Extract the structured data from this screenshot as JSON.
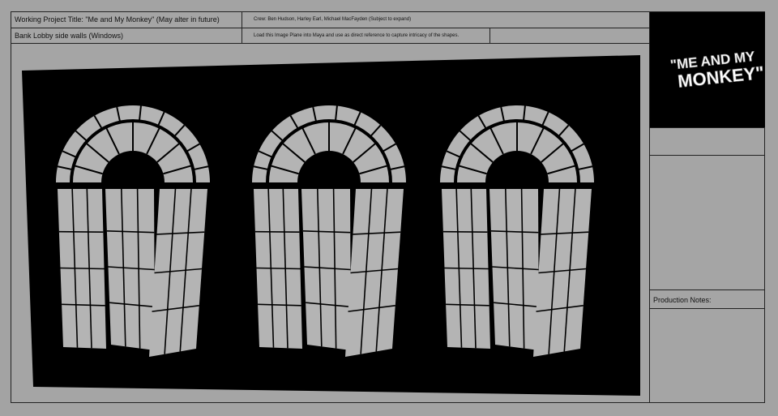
{
  "header": {
    "project_title": "Working Project Title: \"Me and My Monkey\" (May alter in future)",
    "crew": "Crew: Ben Hudson, Harley Earl, Michael MacFayden (Subject to expand)",
    "scene_name": "Bank Lobby side walls (Windows)",
    "instructions": "Load this Image Plane into Maya and use as direct reference to capture intricacy of the shapes."
  },
  "logo": {
    "line1": "\"ME AND MY",
    "line2": "MONKEY\""
  },
  "side_panel": {
    "production_notes_label": "Production Notes:"
  },
  "reference_image": {
    "window_count": 3,
    "colors": {
      "background": "#000000",
      "glass": "#b4b4b4",
      "sheet": "#a5a5a5"
    }
  }
}
